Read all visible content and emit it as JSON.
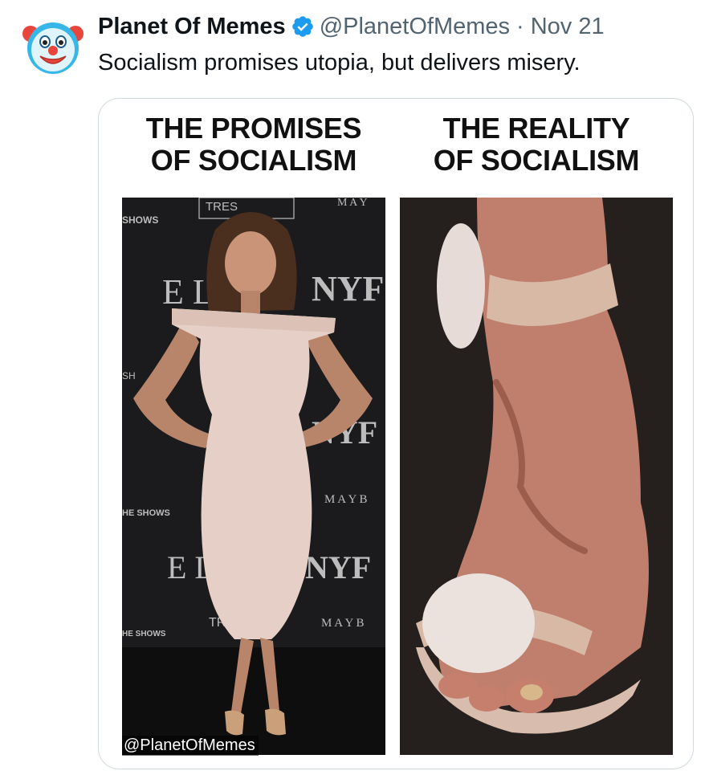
{
  "tweet": {
    "author": {
      "display_name": "Planet Of Memes",
      "handle": "@PlanetOfMemes",
      "verified": true,
      "avatar_icon": "clown-face-icon"
    },
    "separator": "·",
    "date": "Nov 21",
    "text": "Socialism promises utopia, but delivers misery."
  },
  "meme": {
    "left_title_line1": "THE PROMISES",
    "left_title_line2": "OF SOCIALISM",
    "right_title_line1": "THE REALITY",
    "right_title_line2": "OF SOCIALISM",
    "watermark": "@PlanetOfMemes",
    "backdrop_text": {
      "shows": "SHOWS",
      "elle": "E L",
      "nyfw": "NYF",
      "mayb": "M A Y B",
      "may": "M A Y",
      "tre": "TRES",
      "the_shows": "HE SHOWS",
      "sh": "SH",
      "tr": "TR"
    }
  },
  "colors": {
    "verified_blue": "#1d9bf0",
    "text_primary": "#0f1419",
    "text_secondary": "#536471",
    "card_border": "#cfd9de"
  }
}
